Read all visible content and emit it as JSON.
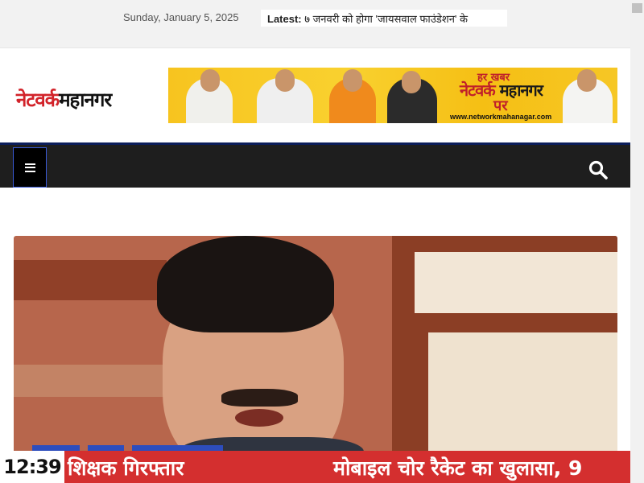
{
  "topbar": {
    "date": "Sunday, January 5, 2025",
    "latest_label": "Latest:",
    "latest_text": "७ जनवरी को होगा 'जायसवाल फाउंडेशन' के"
  },
  "header": {
    "logo_part1": "नेटवर्क",
    "logo_part2": "महानगर",
    "banner": {
      "line1": "हर खबर",
      "line2_red": "नेटवर्क",
      "line2_dark": " महानगर",
      "line3": "पर",
      "url": "www.networkmahanagar.com"
    }
  },
  "nav": {
    "menu_icon": "hamburger-icon",
    "search_icon": "search-icon"
  },
  "ticker": {
    "time": "12:39",
    "item1": "शिक्षक गिरफ्तार",
    "item2": "मोबाइल चोर रैकेट का खुलासा, 9"
  },
  "colors": {
    "accent_red": "#d42f2f",
    "nav_bg": "#1e1e1e",
    "nav_border": "#0b1d5a",
    "menu_border": "#3a5bd9"
  }
}
